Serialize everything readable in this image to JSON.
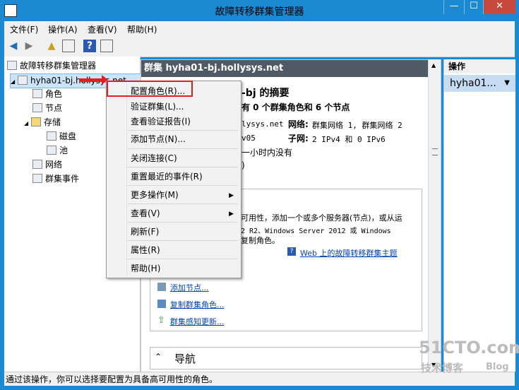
{
  "window": {
    "title": "故障转移群集管理器",
    "buttons": {
      "minimize": "—",
      "maximize": "☐",
      "close": "✕"
    }
  },
  "menubar": [
    {
      "label": "文件(F)"
    },
    {
      "label": "操作(A)"
    },
    {
      "label": "查看(V)"
    },
    {
      "label": "帮助(H)"
    }
  ],
  "toolbar": {
    "icons": [
      "back-arrow-icon",
      "forward-arrow-icon",
      "up-folder-icon",
      "show-hide-tree-icon",
      "help-icon",
      "show-hide-action-pane-icon"
    ]
  },
  "tree": {
    "root": "故障转移群集管理器",
    "cluster": "hyha01-bj.hollysys.net",
    "items": [
      {
        "label": "角色"
      },
      {
        "label": "节点"
      },
      {
        "label": "存储"
      },
      {
        "label": "磁盘"
      },
      {
        "label": "池"
      },
      {
        "label": "网络"
      },
      {
        "label": "群集事件"
      }
    ]
  },
  "center": {
    "header": "群集 hyha01-bj.hollysys.net",
    "summary_title_frag": "-bj 的摘要",
    "summary_sub_frag": "有 0 个群集角色和 6 个节点",
    "domain_frag": "lysys.net",
    "network_label": "网络:",
    "network_value": "群集网络 1, 群集网络 2",
    "node_frag": "v05",
    "subnet_label": "子网:",
    "subnet_value": "2 IPv4 和 0 IPv6",
    "time_frag": "一小时内没有",
    "paren_frag": ")",
    "config_text_1": "可用性，添加一个或多个服务器(节点)，或从运",
    "config_text_2": "2 R2、Windows Server 2012 或 Windows",
    "config_text_3": "复制角色。",
    "web_link": "Web 上的故障转移群集主题",
    "actions": [
      {
        "label": "添加节点..."
      },
      {
        "label": "复制群集角色..."
      },
      {
        "label": "群集感知更新..."
      }
    ],
    "nav_label": "导航"
  },
  "actions_pane": {
    "header": "操作",
    "item": "hyha01..."
  },
  "context_menu": {
    "items": [
      {
        "label": "配置角色(R)..."
      },
      {
        "label": "验证群集(L)..."
      },
      {
        "label": "查看验证报告(I)"
      },
      {
        "label": "添加节点(N)..."
      },
      {
        "label": "关闭连接(C)"
      },
      {
        "label": "重置最近的事件(R)"
      },
      {
        "label": "更多操作(M)"
      },
      {
        "label": "查看(V)"
      },
      {
        "label": "刷新(F)"
      },
      {
        "label": "属性(R)"
      },
      {
        "label": "帮助(H)"
      }
    ]
  },
  "statusbar": {
    "text": "通过该操作，你可以选择要配置为具备高可用性的角色。"
  },
  "watermark": {
    "line1": "51CTO.com",
    "line2": "技术博客",
    "line3": "Blog"
  },
  "colors": {
    "title_bar": "#1c8ad3",
    "header_dark": "#505a64",
    "highlight_red": "#e02020",
    "selected": "#c5dcf3"
  }
}
